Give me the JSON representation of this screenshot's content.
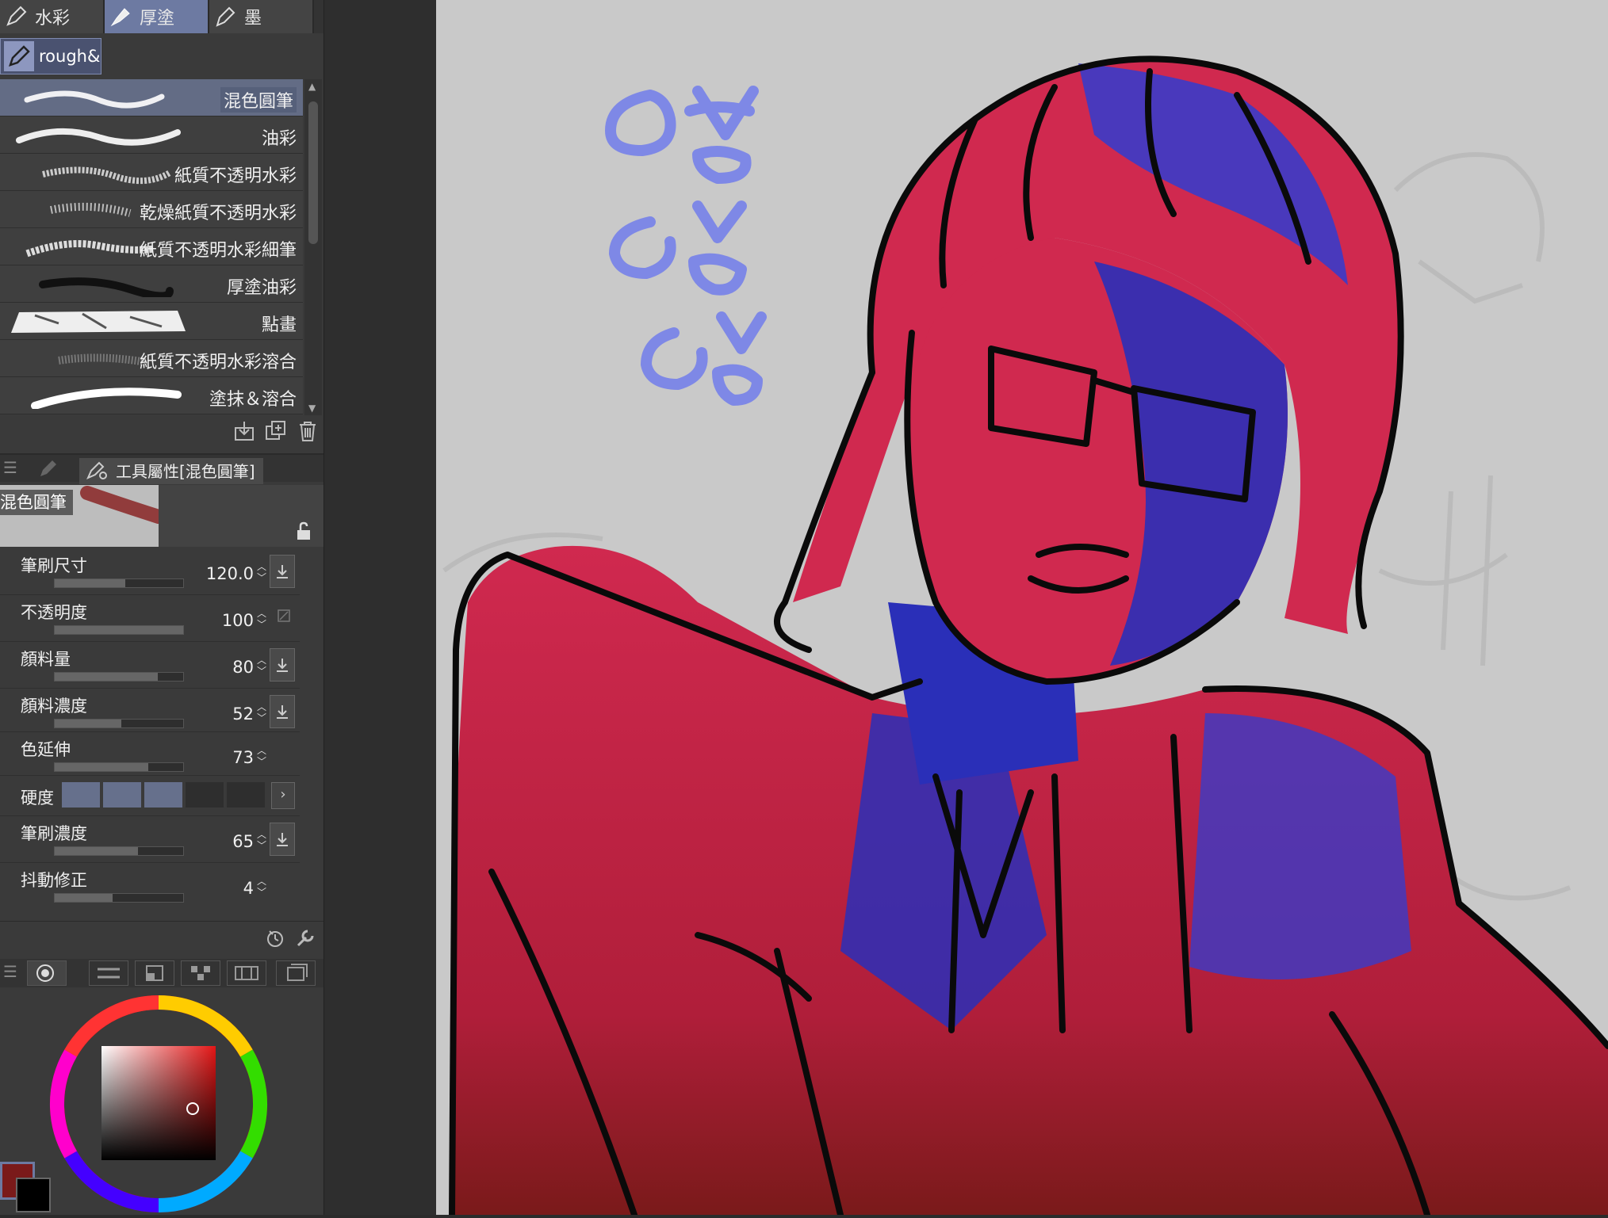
{
  "tabs": [
    {
      "label": "水彩",
      "icon": "brush-tip-icon"
    },
    {
      "label": "厚塗",
      "icon": "flat-brush-icon"
    },
    {
      "label": "墨",
      "icon": "ink-pen-icon"
    }
  ],
  "subtool_set": {
    "label": "rough&c",
    "icon": "pen-icon"
  },
  "brushes": [
    {
      "label": "混色圓筆",
      "active": true
    },
    {
      "label": "油彩"
    },
    {
      "label": "紙質不透明水彩"
    },
    {
      "label": "乾燥紙質不透明水彩"
    },
    {
      "label": "紙質不透明水彩細筆"
    },
    {
      "label": "厚塗油彩"
    },
    {
      "label": "點畫"
    },
    {
      "label": "紙質不透明水彩溶合"
    },
    {
      "label": "塗抹＆溶合"
    }
  ],
  "tool_property": {
    "title": "工具屬性[混色圓筆]",
    "preview_name": "混色圓筆",
    "props": [
      {
        "name": "筆刷尺寸",
        "value": "120.0",
        "level": 0.55
      },
      {
        "name": "不透明度",
        "value": "100",
        "level": 1.0
      },
      {
        "name": "顏料量",
        "value": "80",
        "level": 0.8
      },
      {
        "name": "顏料濃度",
        "value": "52",
        "level": 0.52
      },
      {
        "name": "色延伸",
        "value": "73",
        "level": 0.73
      },
      {
        "name": "筆刷濃度",
        "value": "65",
        "level": 0.65
      },
      {
        "name": "抖動修正",
        "value": "4",
        "level": 0.45
      }
    ],
    "hardness_label": "硬度",
    "hardness_level": 3,
    "hardness_steps": 5
  },
  "colors": {
    "main": "#7a1a1a",
    "sub": "#000000",
    "accent_tab": "#6d7aa2"
  },
  "canvas": {
    "handwriting": [
      "하",
      "하",
      "하"
    ],
    "handwriting_color": "#7e88e6"
  }
}
